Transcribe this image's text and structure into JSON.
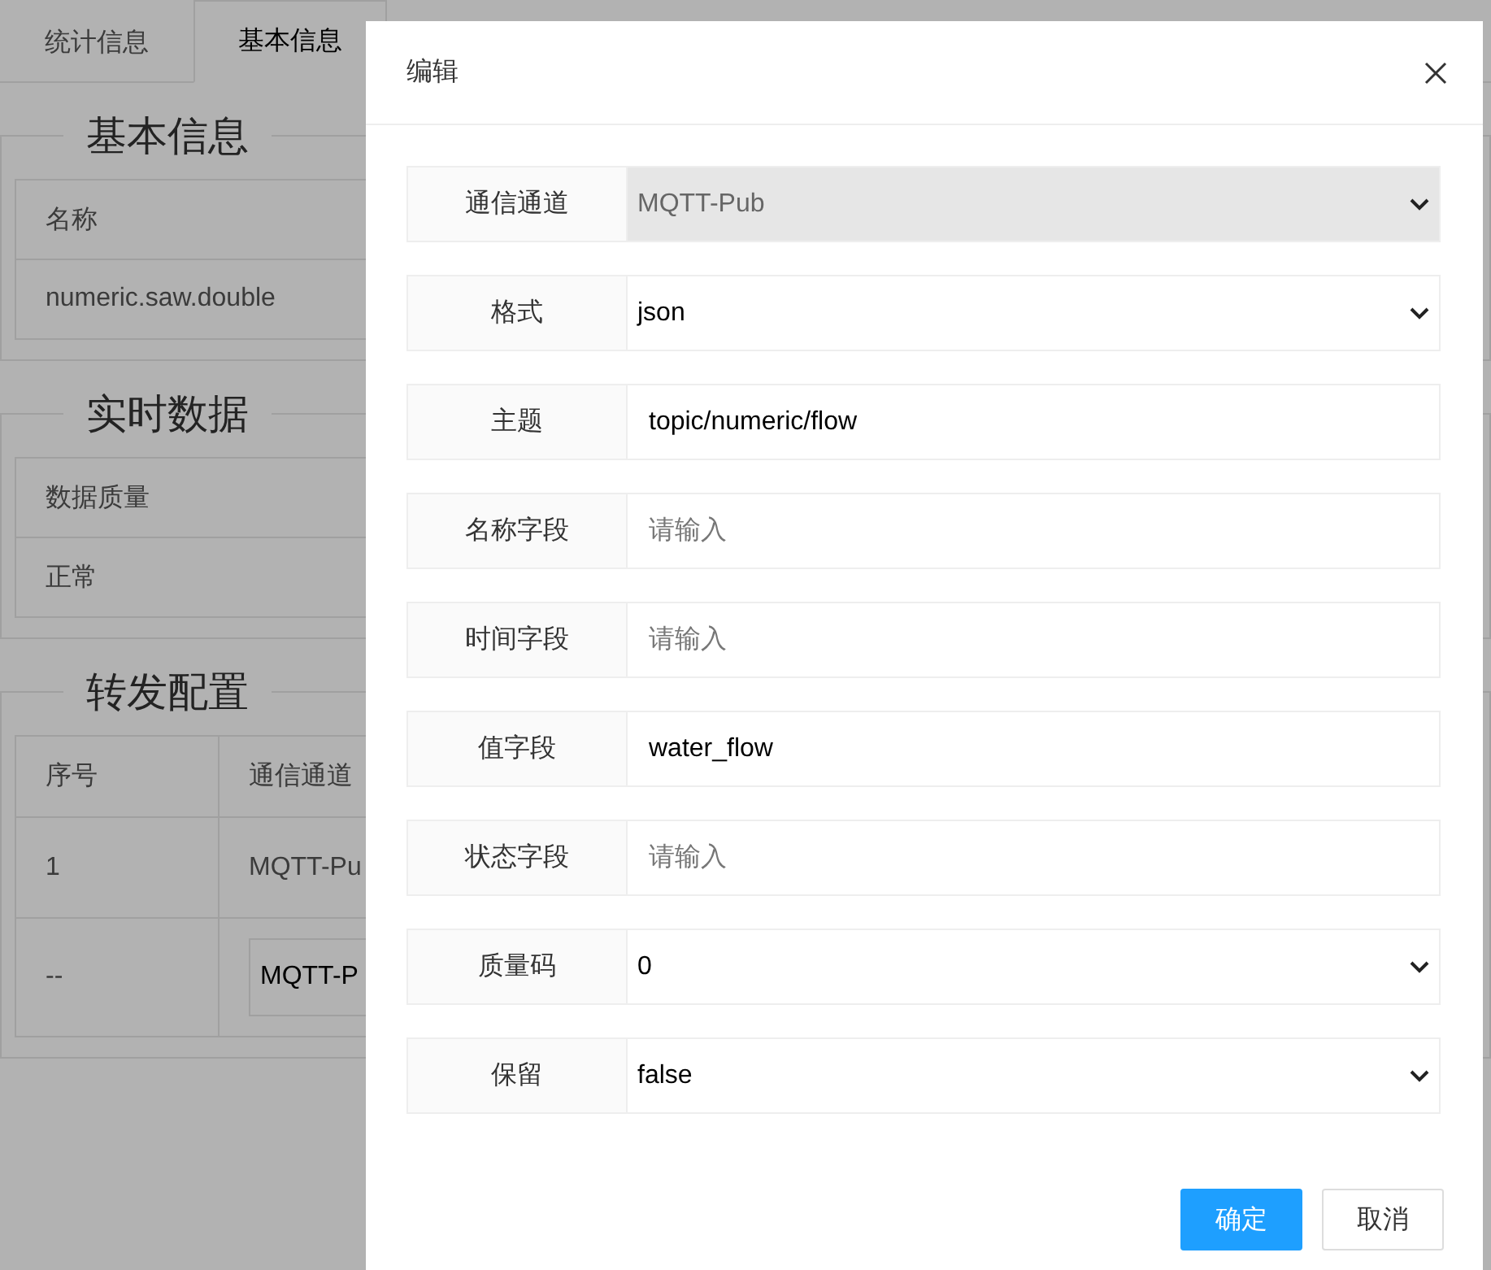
{
  "tabs": [
    {
      "label": "统计信息",
      "selected": false
    },
    {
      "label": "基本信息",
      "selected": true
    }
  ],
  "basic_info": {
    "legend": "基本信息",
    "header": "名称",
    "value": "numeric.saw.double"
  },
  "realtime_data": {
    "legend": "实时数据",
    "header": "数据质量",
    "value": "正常"
  },
  "forward_config": {
    "legend": "转发配置",
    "columns": [
      "序号",
      "通信通道"
    ],
    "rows": [
      {
        "cells": [
          "1",
          "MQTT-Pu"
        ]
      }
    ],
    "new_row": {
      "index": "--",
      "channel": "MQTT-P"
    }
  },
  "dialog": {
    "title": "编辑",
    "fields": [
      {
        "label": "通信通道",
        "kind": "select",
        "value": "MQTT-Pub",
        "disabled": true
      },
      {
        "label": "格式",
        "kind": "select",
        "value": "json",
        "disabled": false
      },
      {
        "label": "主题",
        "kind": "input",
        "value": "topic/numeric/flow"
      },
      {
        "label": "名称字段",
        "kind": "input",
        "placeholder": "请输入"
      },
      {
        "label": "时间字段",
        "kind": "input",
        "placeholder": "请输入"
      },
      {
        "label": "值字段",
        "kind": "input",
        "value": "water_flow"
      },
      {
        "label": "状态字段",
        "kind": "input",
        "placeholder": "请输入"
      },
      {
        "label": "质量码",
        "kind": "select",
        "value": "0",
        "disabled": false
      },
      {
        "label": "保留",
        "kind": "select",
        "value": "false",
        "disabled": false
      }
    ],
    "buttons": [
      {
        "label": "确定",
        "kind": "primary"
      },
      {
        "label": "取消",
        "kind": "default"
      }
    ]
  }
}
